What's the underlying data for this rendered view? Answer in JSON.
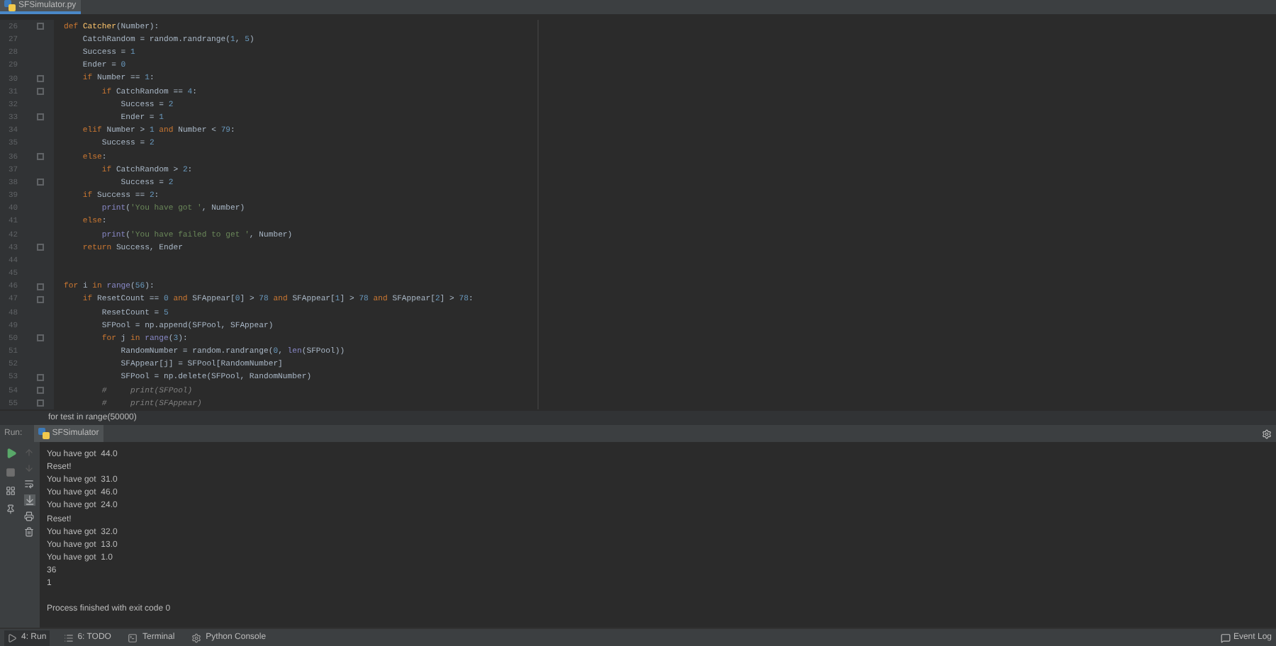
{
  "tabs": [
    {
      "label": "SFSimulator.py",
      "selected": true
    }
  ],
  "editor": {
    "lines": [
      {
        "number": "26",
        "fold": true,
        "tokens": [
          {
            "kind": "kw",
            "text": "def "
          },
          {
            "kind": "fn",
            "text": "Catcher"
          },
          {
            "kind": "p",
            "text": "(Number):"
          }
        ]
      },
      {
        "number": "27",
        "fold": false,
        "tokens": [
          {
            "kind": "p",
            "text": "    CatchRandom = random.randrange("
          },
          {
            "kind": "num",
            "text": "1"
          },
          {
            "kind": "p",
            "text": ", "
          },
          {
            "kind": "num",
            "text": "5"
          },
          {
            "kind": "p",
            "text": ")"
          }
        ]
      },
      {
        "number": "28",
        "fold": false,
        "tokens": [
          {
            "kind": "p",
            "text": "    Success = "
          },
          {
            "kind": "num",
            "text": "1"
          }
        ]
      },
      {
        "number": "29",
        "fold": false,
        "tokens": [
          {
            "kind": "p",
            "text": "    Ender = "
          },
          {
            "kind": "num",
            "text": "0"
          }
        ]
      },
      {
        "number": "30",
        "fold": true,
        "tokens": [
          {
            "kind": "kw",
            "text": "    if "
          },
          {
            "kind": "p",
            "text": "Number == "
          },
          {
            "kind": "num",
            "text": "1"
          },
          {
            "kind": "p",
            "text": ":"
          }
        ]
      },
      {
        "number": "31",
        "fold": true,
        "tokens": [
          {
            "kind": "kw",
            "text": "        if "
          },
          {
            "kind": "p",
            "text": "CatchRandom == "
          },
          {
            "kind": "num",
            "text": "4"
          },
          {
            "kind": "p",
            "text": ":"
          }
        ]
      },
      {
        "number": "32",
        "fold": false,
        "tokens": [
          {
            "kind": "p",
            "text": "            Success = "
          },
          {
            "kind": "num",
            "text": "2"
          }
        ]
      },
      {
        "number": "33",
        "fold": true,
        "tokens": [
          {
            "kind": "p",
            "text": "            Ender = "
          },
          {
            "kind": "num",
            "text": "1"
          }
        ]
      },
      {
        "number": "34",
        "fold": false,
        "tokens": [
          {
            "kind": "kw",
            "text": "    elif "
          },
          {
            "kind": "p",
            "text": "Number > "
          },
          {
            "kind": "num",
            "text": "1"
          },
          {
            "kind": "kw",
            "text": " and "
          },
          {
            "kind": "p",
            "text": "Number < "
          },
          {
            "kind": "num",
            "text": "79"
          },
          {
            "kind": "p",
            "text": ":"
          }
        ]
      },
      {
        "number": "35",
        "fold": false,
        "tokens": [
          {
            "kind": "p",
            "text": "        Success = "
          },
          {
            "kind": "num",
            "text": "2"
          }
        ]
      },
      {
        "number": "36",
        "fold": true,
        "tokens": [
          {
            "kind": "kw",
            "text": "    else"
          },
          {
            "kind": "p",
            "text": ":"
          }
        ]
      },
      {
        "number": "37",
        "fold": false,
        "tokens": [
          {
            "kind": "kw",
            "text": "        if "
          },
          {
            "kind": "p",
            "text": "CatchRandom > "
          },
          {
            "kind": "num",
            "text": "2"
          },
          {
            "kind": "p",
            "text": ":"
          }
        ]
      },
      {
        "number": "38",
        "fold": true,
        "tokens": [
          {
            "kind": "p",
            "text": "            Success = "
          },
          {
            "kind": "num",
            "text": "2"
          }
        ]
      },
      {
        "number": "39",
        "fold": false,
        "tokens": [
          {
            "kind": "kw",
            "text": "    if "
          },
          {
            "kind": "p",
            "text": "Success == "
          },
          {
            "kind": "num",
            "text": "2"
          },
          {
            "kind": "p",
            "text": ":"
          }
        ]
      },
      {
        "number": "40",
        "fold": false,
        "tokens": [
          {
            "kind": "bi",
            "text": "        print"
          },
          {
            "kind": "p",
            "text": "("
          },
          {
            "kind": "str",
            "text": "'You have got '"
          },
          {
            "kind": "p",
            "text": ", Number)"
          }
        ]
      },
      {
        "number": "41",
        "fold": false,
        "tokens": [
          {
            "kind": "kw",
            "text": "    else"
          },
          {
            "kind": "p",
            "text": ":"
          }
        ]
      },
      {
        "number": "42",
        "fold": false,
        "tokens": [
          {
            "kind": "bi",
            "text": "        print"
          },
          {
            "kind": "p",
            "text": "("
          },
          {
            "kind": "str",
            "text": "'You have failed to get '"
          },
          {
            "kind": "p",
            "text": ", Number)"
          }
        ]
      },
      {
        "number": "43",
        "fold": true,
        "tokens": [
          {
            "kind": "kw",
            "text": "    return "
          },
          {
            "kind": "p",
            "text": "Success, Ender"
          }
        ]
      },
      {
        "number": "44",
        "fold": false
      },
      {
        "number": "45",
        "fold": false
      },
      {
        "number": "46",
        "fold": true,
        "tokens": [
          {
            "kind": "kw",
            "text": "for "
          },
          {
            "kind": "p",
            "text": "i "
          },
          {
            "kind": "kw",
            "text": "in "
          },
          {
            "kind": "bi",
            "text": "range"
          },
          {
            "kind": "p",
            "text": "("
          },
          {
            "kind": "num",
            "text": "56"
          },
          {
            "kind": "p",
            "text": "):"
          }
        ]
      },
      {
        "number": "47",
        "fold": true,
        "tokens": [
          {
            "kind": "kw",
            "text": "    if "
          },
          {
            "kind": "p",
            "text": "ResetCount == "
          },
          {
            "kind": "num",
            "text": "0"
          },
          {
            "kind": "kw",
            "text": " and "
          },
          {
            "kind": "p",
            "text": "SFAppear["
          },
          {
            "kind": "num",
            "text": "0"
          },
          {
            "kind": "p",
            "text": "] > "
          },
          {
            "kind": "num",
            "text": "78"
          },
          {
            "kind": "kw",
            "text": " and "
          },
          {
            "kind": "p",
            "text": "SFAppear["
          },
          {
            "kind": "num",
            "text": "1"
          },
          {
            "kind": "p",
            "text": "] > "
          },
          {
            "kind": "num",
            "text": "78"
          },
          {
            "kind": "kw",
            "text": " and "
          },
          {
            "kind": "p",
            "text": "SFAppear["
          },
          {
            "kind": "num",
            "text": "2"
          },
          {
            "kind": "p",
            "text": "] > "
          },
          {
            "kind": "num",
            "text": "78"
          },
          {
            "kind": "p",
            "text": ":"
          }
        ]
      },
      {
        "number": "48",
        "fold": false,
        "tokens": [
          {
            "kind": "p",
            "text": "        ResetCount = "
          },
          {
            "kind": "num",
            "text": "5"
          }
        ]
      },
      {
        "number": "49",
        "fold": false,
        "tokens": [
          {
            "kind": "p",
            "text": "        SFPool = np.append(SFPool, SFAppear)"
          }
        ]
      },
      {
        "number": "50",
        "fold": true,
        "tokens": [
          {
            "kind": "kw",
            "text": "        for "
          },
          {
            "kind": "p",
            "text": "j "
          },
          {
            "kind": "kw",
            "text": "in "
          },
          {
            "kind": "bi",
            "text": "range"
          },
          {
            "kind": "p",
            "text": "("
          },
          {
            "kind": "num",
            "text": "3"
          },
          {
            "kind": "p",
            "text": "):"
          }
        ]
      },
      {
        "number": "51",
        "fold": false,
        "tokens": [
          {
            "kind": "p",
            "text": "            RandomNumber = random.randrange("
          },
          {
            "kind": "num",
            "text": "0"
          },
          {
            "kind": "p",
            "text": ", "
          },
          {
            "kind": "bi",
            "text": "len"
          },
          {
            "kind": "p",
            "text": "(SFPool))"
          }
        ]
      },
      {
        "number": "52",
        "fold": false,
        "tokens": [
          {
            "kind": "p",
            "text": "            SFAppear[j] = SFPool[RandomNumber]"
          }
        ]
      },
      {
        "number": "53",
        "fold": true,
        "tokens": [
          {
            "kind": "p",
            "text": "            SFPool = np.delete(SFPool, RandomNumber)"
          }
        ]
      },
      {
        "number": "54",
        "fold": true,
        "tokens": [
          {
            "kind": "cm",
            "text": "        #     print(SFPool)"
          }
        ]
      },
      {
        "number": "55",
        "fold": true,
        "tokens": [
          {
            "kind": "cm",
            "text": "        #     print(SFAppear)"
          }
        ]
      }
    ]
  },
  "breadcrumb": "for test in range(50000)",
  "run_panel": {
    "label": "Run:",
    "tab": "SFSimulator",
    "output": [
      "You have got  44.0",
      "Reset!",
      "You have got  31.0",
      "You have got  46.0",
      "You have got  24.0",
      "Reset!",
      "You have got  32.0",
      "You have got  13.0",
      "You have got  1.0",
      "36",
      "1"
    ],
    "exit_message": "Process finished with exit code 0"
  },
  "bottom_bar": {
    "tools": [
      {
        "kind": "run",
        "label": "4: Run",
        "selected": true
      },
      {
        "kind": "todo",
        "label": "6: TODO",
        "selected": false
      },
      {
        "kind": "terminal",
        "label": "Terminal",
        "selected": false
      },
      {
        "kind": "python",
        "label": "Python Console",
        "selected": false
      }
    ],
    "event_log": "Event Log"
  }
}
